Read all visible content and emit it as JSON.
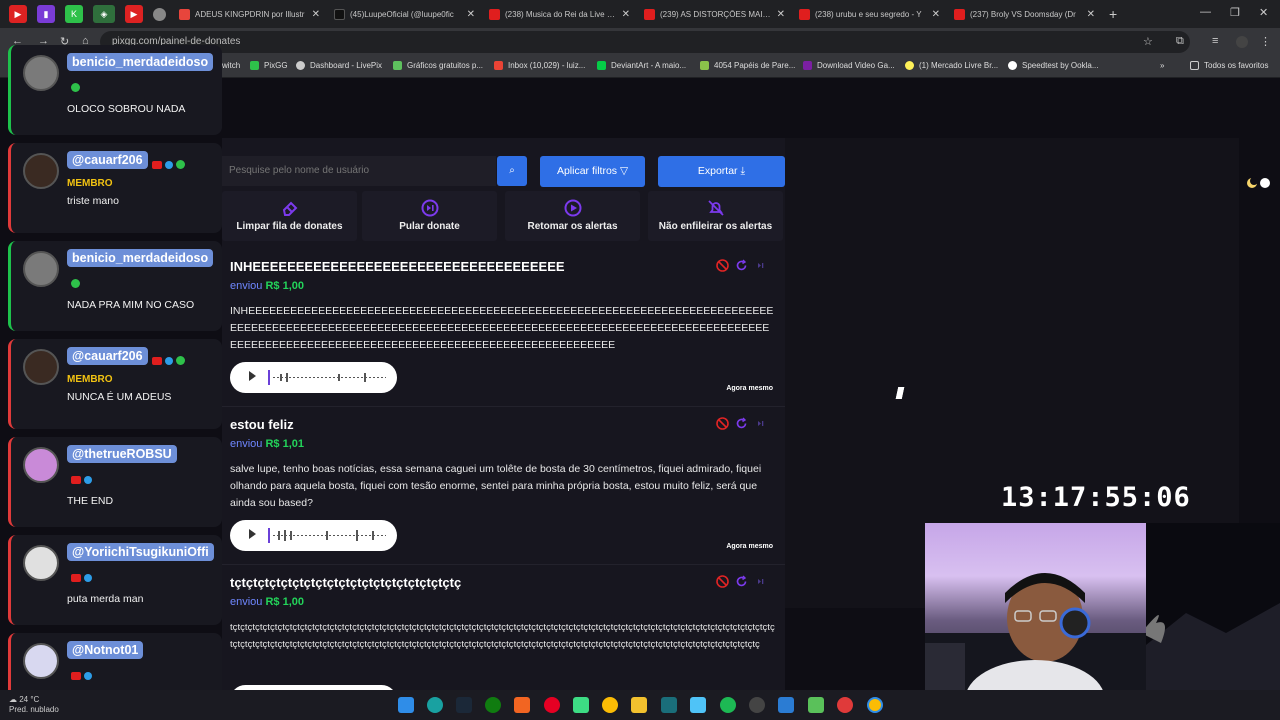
{
  "browser": {
    "tabs": [
      {
        "title": "ADEUS KINGPDRIN por Illustr",
        "color": "#e8453c"
      },
      {
        "title": "(45)LuupeOficial (@luupe0fic",
        "color": "#111111"
      },
      {
        "title": "(238) Musica do Rei da Live - Y",
        "color": "#e01e1e"
      },
      {
        "title": "(239) AS DISTORÇÕES MAIS C",
        "color": "#e01e1e"
      },
      {
        "title": "(238) urubu e seu segredo - Y",
        "color": "#e01e1e"
      },
      {
        "title": "(237) Broly VS Doomsday (Dr",
        "color": "#e01e1e"
      }
    ],
    "new_tab": "+",
    "url": "pixgg.com/painel-de-donates",
    "bookmarks": [
      {
        "label": "witch",
        "color": "#9146ff"
      },
      {
        "label": "PixGG",
        "color": "#2ec14a"
      },
      {
        "label": "Dashboard - LivePix",
        "color": "#cccccc"
      },
      {
        "label": "Gráficos gratuitos p...",
        "color": "#5ec15e"
      },
      {
        "label": "Inbox (10,029) - luiz...",
        "color": "#ea4335"
      },
      {
        "label": "DeviantArt - A maio...",
        "color": "#05cc47"
      },
      {
        "label": "4054 Papéis de Pare...",
        "color": "#8bc34a"
      },
      {
        "label": "Download Video Ga...",
        "color": "#7b1fa2"
      },
      {
        "label": "(1) Mercado Livre Br...",
        "color": "#fff159"
      },
      {
        "label": "Speedtest by Ookla...",
        "color": "#ffffff"
      }
    ],
    "favorites_label": "Todos os favoritos"
  },
  "chat": [
    {
      "user": "benicio_merdadeidoso",
      "membro": "",
      "text": "OLOCO SOBROU NADA",
      "border": "green",
      "badges": [
        "g"
      ],
      "avatar": "#7a7a7a"
    },
    {
      "user": "@cauarf206",
      "membro": "MEMBRO",
      "text": "triste mano",
      "border": "red",
      "badges": [
        "y",
        "b",
        "g"
      ],
      "avatar": "#3a2a22"
    },
    {
      "user": "benicio_merdadeidoso",
      "membro": "",
      "text": "NADA PRA MIM NO CASO",
      "border": "green",
      "badges": [
        "g"
      ],
      "avatar": "#7a7a7a"
    },
    {
      "user": "@cauarf206",
      "membro": "MEMBRO",
      "text": "NUNCA É UM ADEUS",
      "border": "red",
      "badges": [
        "y",
        "b",
        "g"
      ],
      "avatar": "#3a2a22"
    },
    {
      "user": "@thetrueROBSU",
      "membro": "",
      "text": "THE END",
      "border": "red",
      "badges": [
        "y",
        "b"
      ],
      "avatar": "#c98ad8"
    },
    {
      "user": "@YoriichiTsugikuniOffi",
      "membro": "",
      "text": "puta merda man",
      "border": "red",
      "badges": [
        "y",
        "b"
      ],
      "avatar": "#e0e0e0"
    },
    {
      "user": "@Notnot01",
      "membro": "",
      "text": "",
      "border": "red",
      "badges": [
        "y",
        "b"
      ],
      "avatar": "#d8d8f0"
    }
  ],
  "panel": {
    "search_placeholder": "Pesquise pelo nome de usuário",
    "filters_label": "Aplicar filtros",
    "export_label": "Exportar",
    "actions": [
      {
        "label": "Limpar fila de donates",
        "icon": "eraser-icon"
      },
      {
        "label": "Pular donate",
        "icon": "skip-icon"
      },
      {
        "label": "Retomar os alertas",
        "icon": "play-icon"
      },
      {
        "label": "Não enfileirar os alertas",
        "icon": "bell-off-icon"
      }
    ],
    "envio_label": "enviou",
    "donates": [
      {
        "title": "INHEEEEEEEEEEEEEEEEEEEEEEEEEEEEEEEEEEEE",
        "amount": "R$ 1,00",
        "message": "INHEEEEEEEEEEEEEEEEEEEEEEEEEEEEEEEEEEEEEEEEEEEEEEEEEEEEEEEEEEEEEEEEEEEEEEEEEEEEEEEEEEEEEEEEEEEEEEEEEEEEEEEEEEEEEEEEEEEEEEEEEEEEEEEEEEEEEEEEEEEEEEEEEEEEEEEEEEEEEEEEEEEEEEEEEEEEEEEEEEEEEEEEEEEEEEEEEEEEEEEEEEEEEEE",
        "time": "Agora mesmo"
      },
      {
        "title": "estou feliz",
        "amount": "R$ 1,01",
        "message": "salve lupe, tenho boas notícias, essa semana caguei um tolête de bosta de 30 centímetros, fiquei admirado, fiquei olhando para aquela bosta, fiquei com tesão enorme, sentei para minha própria bosta, estou muito feliz, será que ainda sou based?",
        "time": "Agora mesmo"
      },
      {
        "title": "tçtçtçtçtçtçtçtçtçtçtçtçtçtçtçtçtçtçtçtç",
        "amount": "R$ 1,00",
        "message": "tçtçtçtçtçtçtçtçtçtçtçtçtçtçtçtçtçtçtçtçtçtçtçtçtçtçtçtçtçtçtçtçtçtçtçtçtçtçtçtçtçtçtçtçtçtçtçtçtçtçtçtçtçtçtçtçtçtçtçtçtçtçtçtçtçtçtçtçtçtçtçtçtçtçtçtçtçtçtçtçtçtçtçtçtçtçtçtçtçtçtçtçtçtçtçtçtçtçtçtçtçtçtçtçtçtçtçtçtçtçtçtçtçtçtçtçtçtçtçtçtçtçtçtçtçtçtçtçtçtçtçtçtçtçtçtçtçtçtçtçtçtçtçtç",
        "time": ""
      }
    ]
  },
  "clock": "13:17:55:06",
  "taskbar": {
    "weather_temp": "24 °C",
    "weather_desc": "Pred. nublado"
  },
  "colors": {
    "accent": "#2f6fe6",
    "amount": "#23d45a",
    "envio": "#6f87ff",
    "icon": "#7c3aed"
  }
}
